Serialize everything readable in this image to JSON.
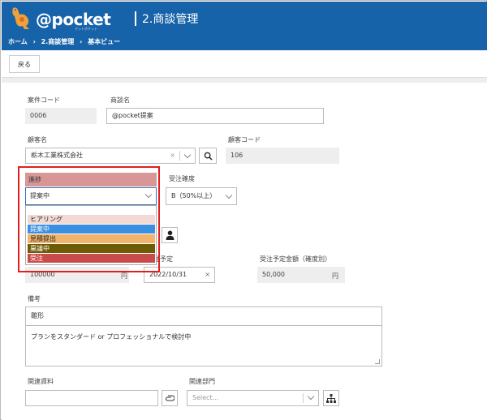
{
  "header": {
    "logo_text": "@pocket",
    "logo_sub": "アットポケット",
    "app_title": "2.商談管理",
    "breadcrumb": [
      "ホーム",
      "›",
      "2.商談管理",
      "›",
      "基本ビュー"
    ]
  },
  "toolbar": {
    "back_label": "戻る"
  },
  "form": {
    "case_code_label": "案件コード",
    "case_code_value": "0006",
    "deal_name_label": "商談名",
    "deal_name_value": "@pocket提案",
    "customer_label": "顧客名",
    "customer_value": "栃木工業株式会社",
    "customer_clear": "×",
    "customer_code_label": "顧客コード",
    "customer_code_value": "106",
    "progress_label": "進捗",
    "progress_value": "提案中",
    "progress_options": [
      {
        "label": "ヒアリング",
        "color": "#f3d9d3"
      },
      {
        "label": "提案中",
        "color": "#3c8fe0"
      },
      {
        "label": "見積提出",
        "color": "#f0b46a"
      },
      {
        "label": "稟議中",
        "color": "#6f5a06"
      },
      {
        "label": "受注",
        "color": "#c94a4a"
      }
    ],
    "probability_label": "受注確度",
    "probability_value": "B（50%以上）",
    "amount_value": "100000",
    "amount_unit": "円",
    "planned_date_label": "注予定",
    "planned_date_value": "2022/10/31",
    "planned_date_clear": "×",
    "expected_amount_label": "受注予定金額（確度別）",
    "expected_amount_value": "50,000",
    "expected_amount_unit": "円",
    "memo_label": "備考",
    "memo_title": "雛形",
    "memo_body": "プランをスタンダード or プロフェッショナルで検討中",
    "related_docs_label": "関連資料",
    "related_dept_label": "関連部門",
    "related_dept_placeholder": "Select..."
  },
  "colors": {
    "brand": "#1763a9",
    "highlight": "#e02020",
    "progress_label_bg": "#d99696"
  }
}
